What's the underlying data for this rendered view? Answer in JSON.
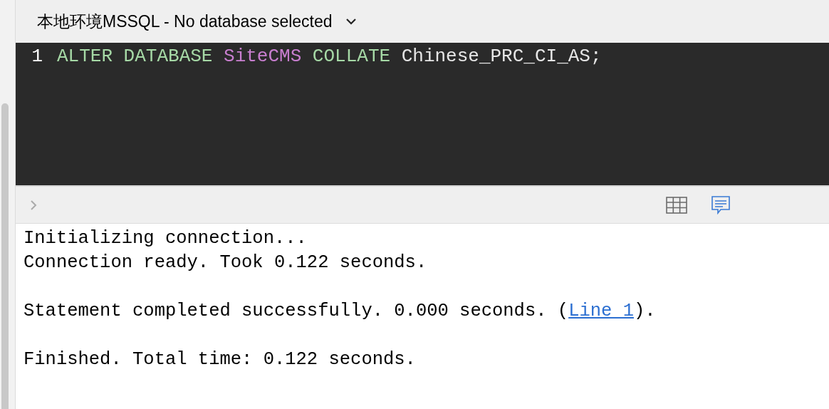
{
  "header": {
    "title": "本地环境MSSQL - No database selected"
  },
  "editor": {
    "lines": [
      {
        "number": "1",
        "tokens": [
          {
            "text": "ALTER DATABASE",
            "kind": "keyword"
          },
          {
            "text": "SiteCMS",
            "kind": "identifier"
          },
          {
            "text": "COLLATE",
            "kind": "keyword"
          },
          {
            "text": "Chinese_PRC_CI_AS;",
            "kind": "plain"
          }
        ]
      }
    ]
  },
  "results_toolbar": {
    "tabs": [
      {
        "kind": "grid",
        "selected": false
      },
      {
        "kind": "messages",
        "selected": true
      }
    ]
  },
  "output": {
    "paragraphs": [
      [
        [
          {
            "text": "Initializing connection...",
            "kind": "text"
          }
        ],
        [
          {
            "text": "Connection ready. Took 0.122 seconds.",
            "kind": "text"
          }
        ]
      ],
      [
        [
          {
            "text": "Statement completed successfully. 0.000 seconds. (",
            "kind": "text"
          },
          {
            "text": "Line 1",
            "kind": "link"
          },
          {
            "text": ").",
            "kind": "text"
          }
        ]
      ],
      [
        [
          {
            "text": "Finished. Total time: 0.122 seconds.",
            "kind": "text"
          }
        ]
      ]
    ]
  }
}
